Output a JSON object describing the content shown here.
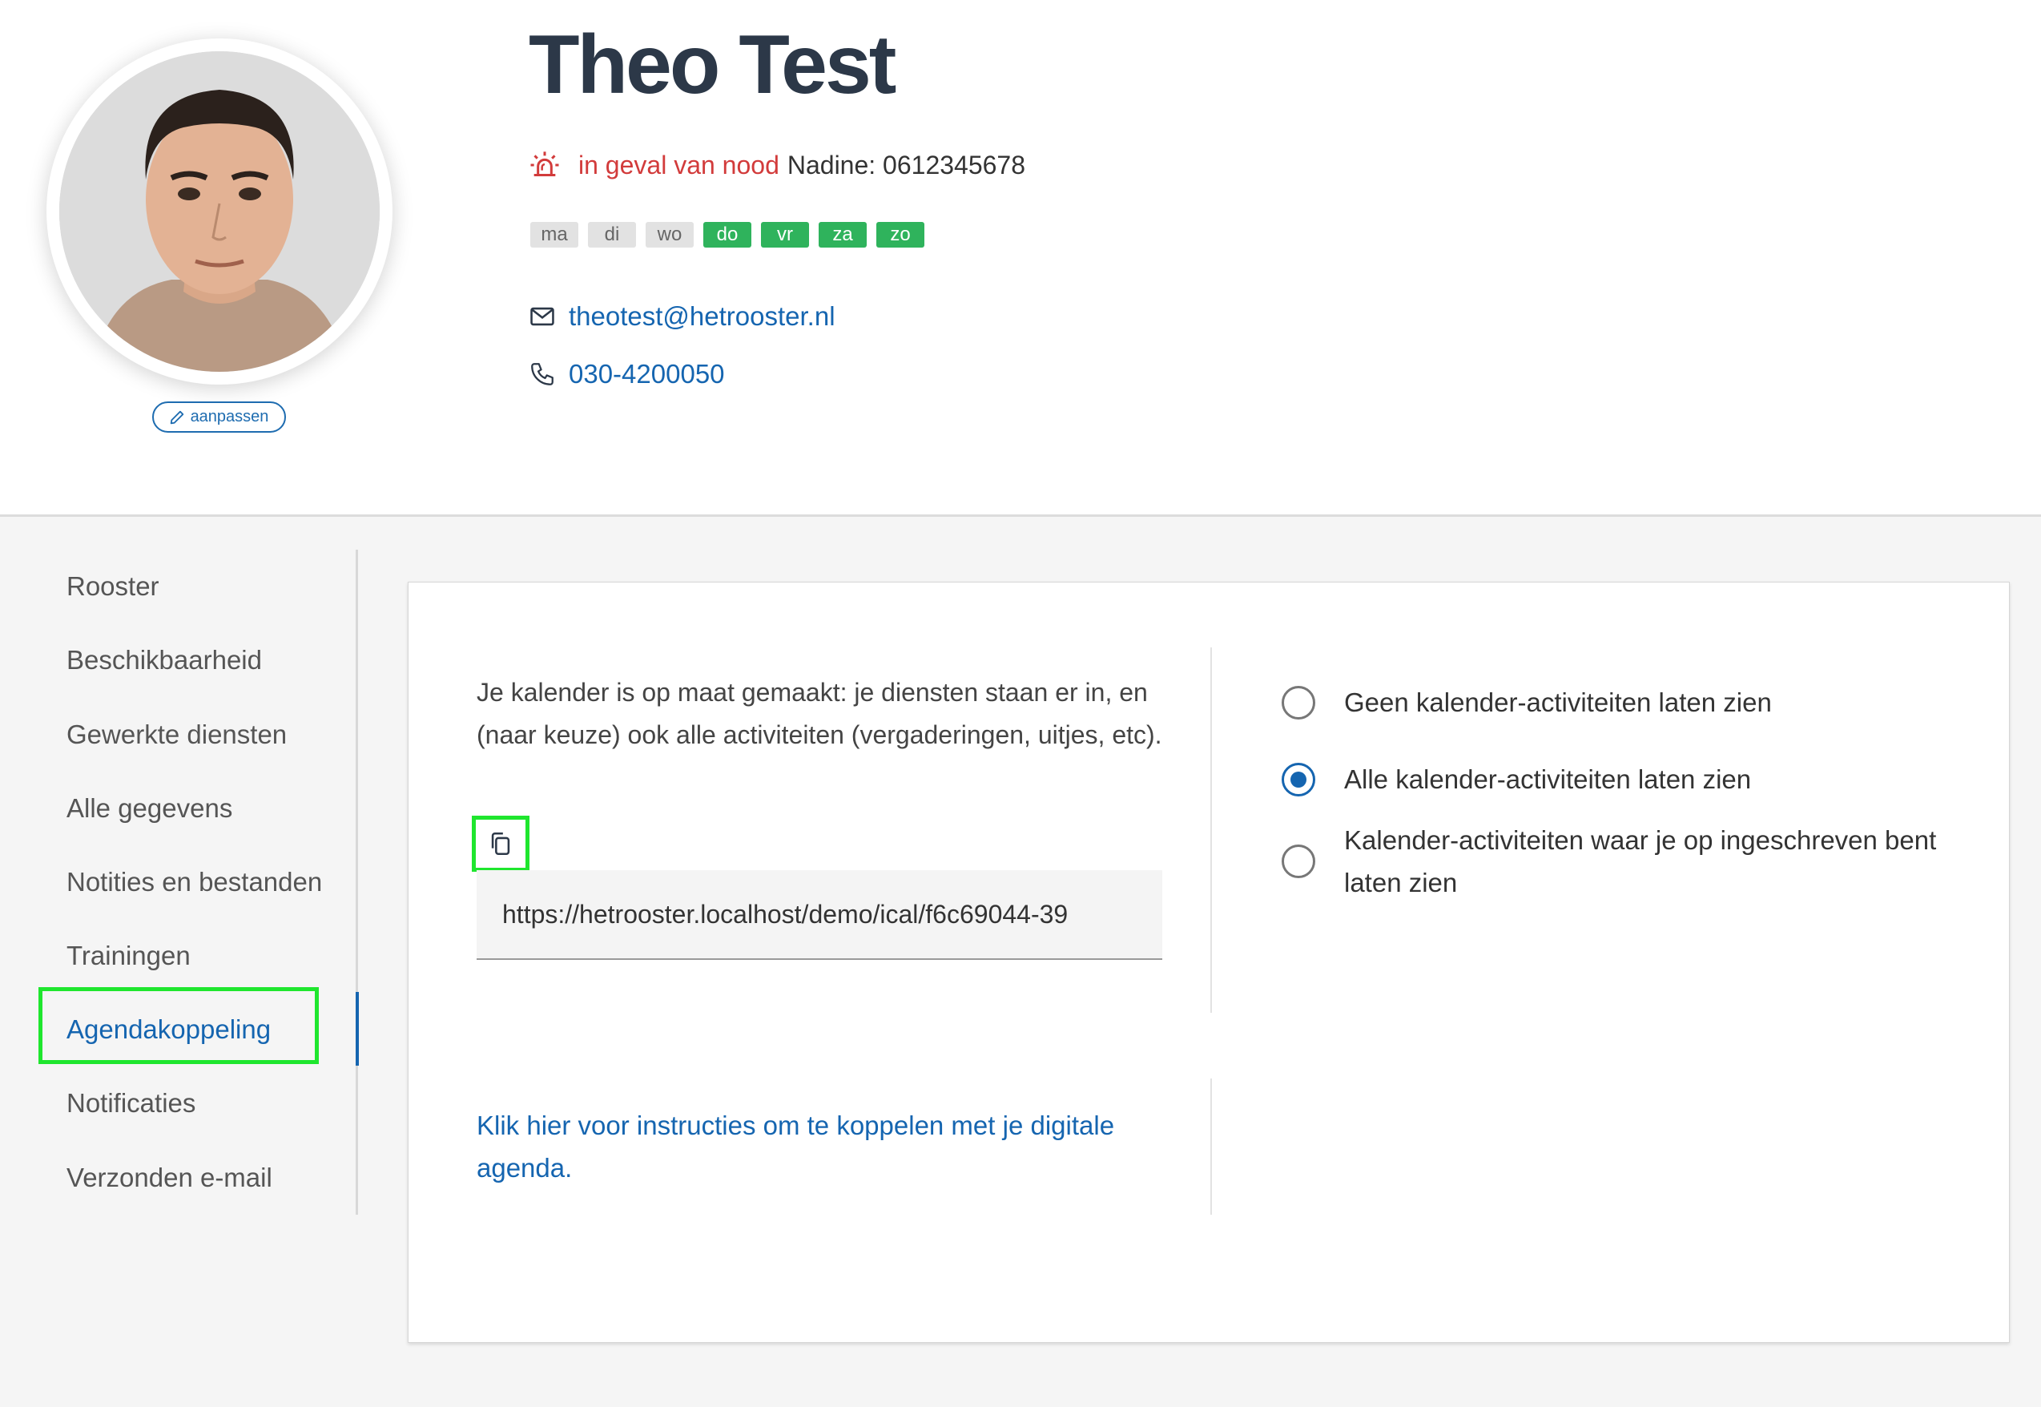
{
  "profile": {
    "name": "Theo Test",
    "edit_label": "aanpassen",
    "emergency_label": "in geval van nood",
    "emergency_contact": "Nadine: 0612345678",
    "email": "theotest@hetrooster.nl",
    "phone": "030-4200050",
    "days": [
      {
        "label": "ma",
        "active": false
      },
      {
        "label": "di",
        "active": false
      },
      {
        "label": "wo",
        "active": false
      },
      {
        "label": "do",
        "active": true
      },
      {
        "label": "vr",
        "active": true
      },
      {
        "label": "za",
        "active": true
      },
      {
        "label": "zo",
        "active": true
      }
    ]
  },
  "sidebar": {
    "items": [
      {
        "label": "Rooster"
      },
      {
        "label": "Beschikbaarheid"
      },
      {
        "label": "Gewerkte diensten"
      },
      {
        "label": "Alle gegevens"
      },
      {
        "label": "Notities en bestanden"
      },
      {
        "label": "Trainingen"
      },
      {
        "label": "Agendakoppeling",
        "active": true
      },
      {
        "label": "Notificaties"
      },
      {
        "label": "Verzonden e-mail"
      }
    ]
  },
  "calendar": {
    "description": "Je kalender is op maat gemaakt: je diensten staan er in, en (naar keuze) ook alle activiteiten (vergaderingen, uitjes, etc).",
    "ical_url": "https://hetrooster.localhost/demo/ical/f6c69044-39",
    "instructions_link": "Klik hier voor instructies om te koppelen met je digitale agenda.",
    "options": [
      {
        "label": "Geen kalender-activiteiten laten zien",
        "checked": false
      },
      {
        "label": "Alle kalender-activiteiten laten zien",
        "checked": true
      },
      {
        "label": "Kalender-activiteiten waar je op ingeschreven bent laten zien",
        "checked": false
      }
    ]
  },
  "colors": {
    "accent": "#1565b0",
    "emergency": "#d23b3b",
    "day_active": "#2fb35c",
    "day_inactive": "#e2e2e2",
    "highlight": "#1fe62e"
  },
  "icons": {
    "edit": "pencil-icon",
    "emergency": "siren-icon",
    "email": "envelope-icon",
    "phone": "phone-icon",
    "copy": "copy-icon"
  }
}
